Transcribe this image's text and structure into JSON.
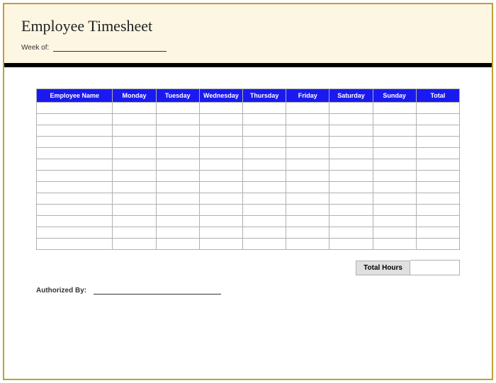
{
  "title": "Employee Timesheet",
  "week_label": "Week of:",
  "columns": {
    "c0": "Employee Name",
    "c1": "Monday",
    "c2": "Tuesday",
    "c3": "Wednesday",
    "c4": "Thursday",
    "c5": "Friday",
    "c6": "Saturday",
    "c7": "Sunday",
    "c8": "Total"
  },
  "total_hours_label": "Total Hours",
  "authorized_label": "Authorized By:"
}
